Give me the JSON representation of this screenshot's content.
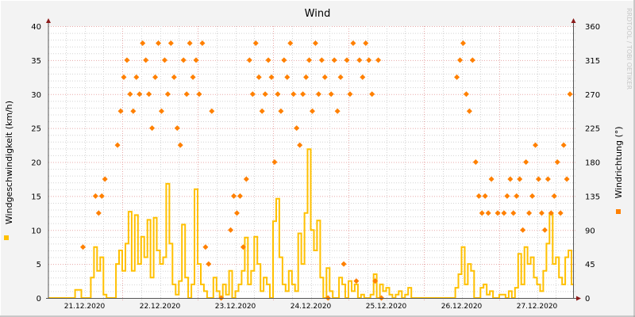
{
  "chart_data": {
    "type": "line",
    "title": "Wind",
    "ylabel": "Windgeschwindigkeit (km/h)",
    "y2label": "Windrichtung (°)",
    "watermark": "RRDTOOL / TOBI OETIKER",
    "ylim": [
      0,
      40
    ],
    "y2lim": [
      0,
      360
    ],
    "yticks": [
      0,
      5,
      10,
      15,
      20,
      25,
      30,
      35,
      40
    ],
    "y2ticks": [
      0,
      45,
      90,
      135,
      180,
      225,
      270,
      315,
      360
    ],
    "x_unit": "hours since 21.12.2020 00:00",
    "xlim": [
      0.5,
      167.5
    ],
    "x_tick_labels": [
      "21.12.2020",
      "22.12.2020",
      "23.12.2020",
      "24.12.2020",
      "25.12.2020",
      "26.12.2020",
      "27.12.2020"
    ],
    "grid": true,
    "legend_placement": "left and right side (color squares only)",
    "colors": {
      "speed": "#ffc000",
      "direction": "#ff8000",
      "major_grid": "#e8a8a8",
      "minor_grid": "#d4d4d4",
      "axis": "#555555",
      "arrow": "#8b1a1a"
    },
    "series": [
      {
        "name": "Windgeschwindigkeit",
        "kind": "step",
        "axis": "left",
        "values": [
          0,
          0,
          0,
          0,
          0,
          0,
          0,
          0,
          0,
          1.2,
          1.2,
          0,
          0,
          0,
          3,
          7.5,
          4,
          6,
          0.5,
          0,
          0,
          0,
          5,
          7,
          4,
          8,
          12.7,
          4,
          12.2,
          5,
          9,
          6,
          11.5,
          3,
          11.8,
          7,
          5,
          6,
          16.8,
          8,
          2,
          0.5,
          2.5,
          10.8,
          3,
          0,
          2,
          16,
          5,
          2,
          1,
          0,
          0,
          3,
          1,
          0,
          2,
          0.5,
          4,
          0,
          1,
          2,
          4,
          8.9,
          2,
          4,
          9,
          5,
          1,
          3,
          2,
          0,
          11.3,
          14.6,
          6,
          2,
          1,
          4,
          2,
          1,
          9.5,
          5,
          12.5,
          21.9,
          10,
          7,
          11.4,
          3,
          0,
          4.4,
          1,
          0,
          0,
          3,
          2,
          0,
          2.5,
          1,
          2,
          0,
          0.5,
          0,
          0,
          0.5,
          3.5,
          0,
          2,
          1,
          1.5,
          0.5,
          0,
          0.5,
          1,
          0,
          0.5,
          1.5,
          0,
          0,
          0,
          0,
          0,
          0,
          0,
          0,
          0,
          0,
          0,
          0,
          0,
          0,
          1.5,
          3.5,
          7.5,
          2,
          5,
          4,
          0,
          0,
          1.5,
          2,
          0.5,
          1,
          0,
          0,
          0.5,
          0.5,
          0,
          1,
          0,
          1.5,
          6.5,
          2,
          7.5,
          5,
          6,
          3,
          2,
          1,
          4,
          8,
          12.5,
          5,
          6,
          3,
          2,
          6,
          7,
          2
        ]
      },
      {
        "name": "Windrichtung",
        "kind": "points",
        "axis": "right",
        "values": [
          null,
          null,
          null,
          null,
          null,
          null,
          null,
          null,
          null,
          null,
          null,
          67.5,
          null,
          null,
          null,
          135,
          112.5,
          135,
          157.5,
          null,
          null,
          null,
          202.5,
          247.5,
          292.5,
          315,
          270,
          247.5,
          292.5,
          270,
          337.5,
          315,
          270,
          225,
          292.5,
          337.5,
          247.5,
          315,
          270,
          337.5,
          292.5,
          225,
          202.5,
          315,
          270,
          337.5,
          292.5,
          315,
          270,
          337.5,
          67.5,
          45,
          247.5,
          null,
          null,
          0,
          null,
          null,
          90,
          135,
          112.5,
          135,
          67.5,
          157.5,
          315,
          270,
          337.5,
          292.5,
          247.5,
          270,
          315,
          292.5,
          180,
          270,
          247.5,
          315,
          292.5,
          337.5,
          270,
          225,
          202.5,
          270,
          292.5,
          315,
          247.5,
          337.5,
          270,
          315,
          292.5,
          0,
          270,
          315,
          247.5,
          292.5,
          45,
          315,
          270,
          337.5,
          22.5,
          315,
          292.5,
          337.5,
          315,
          270,
          22.5,
          315,
          0,
          null,
          null,
          null,
          null,
          null,
          null,
          null,
          null,
          null,
          null,
          null,
          null,
          null,
          null,
          null,
          null,
          null,
          null,
          null,
          null,
          null,
          null,
          null,
          292.5,
          315,
          337.5,
          270,
          247.5,
          315,
          180,
          135,
          112.5,
          135,
          112.5,
          157.5,
          null,
          112.5,
          null,
          112.5,
          135,
          157.5,
          112.5,
          135,
          157.5,
          90,
          180,
          112.5,
          135,
          202.5,
          157.5,
          112.5,
          90,
          157.5,
          112.5,
          135,
          180,
          112.5,
          202.5,
          157.5,
          270,
          135
        ]
      }
    ]
  }
}
